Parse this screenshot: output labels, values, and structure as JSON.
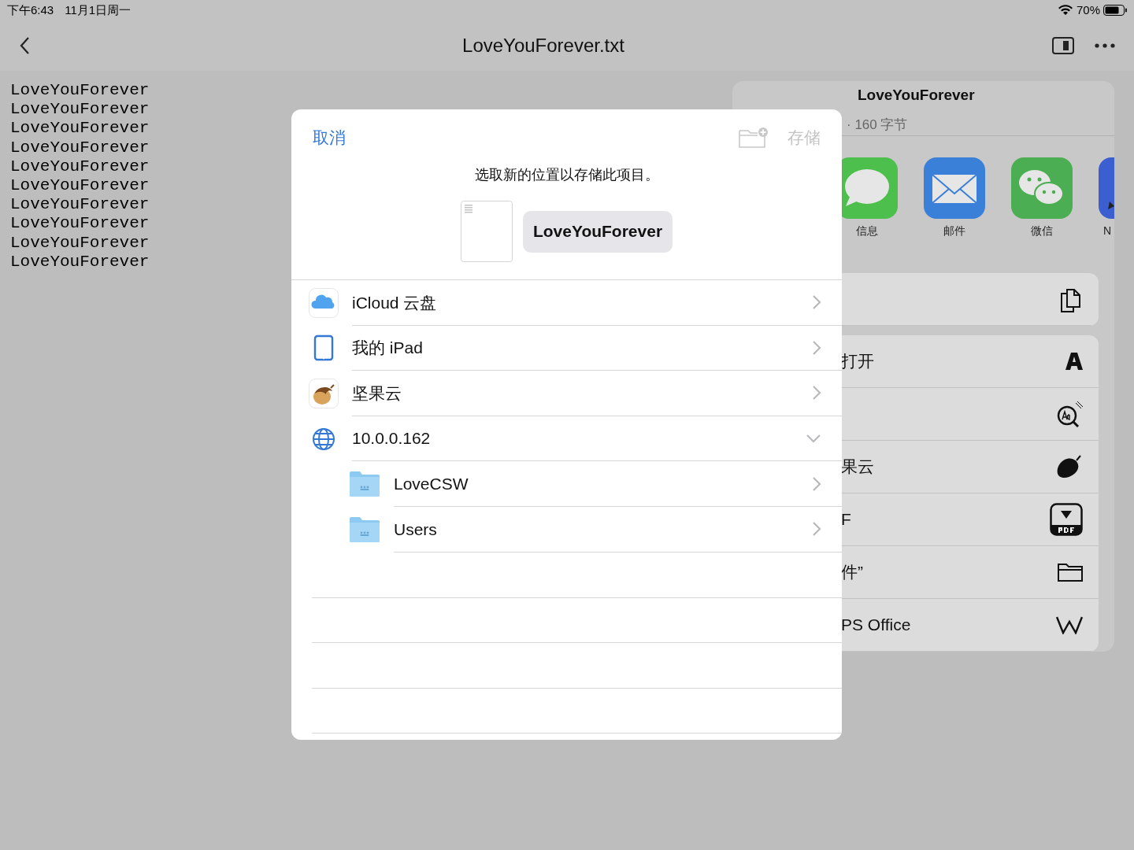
{
  "status_bar": {
    "time": "下午6:43",
    "date": "11月1日周一",
    "battery": "70%"
  },
  "nav": {
    "title": "LoveYouForever.txt"
  },
  "document": {
    "lines": [
      "LoveYouForever",
      "LoveYouForever",
      "LoveYouForever",
      "LoveYouForever",
      "LoveYouForever",
      "LoveYouForever",
      "LoveYouForever",
      "LoveYouForever",
      "LoveYouForever",
      "LoveYouForever"
    ]
  },
  "share_sheet": {
    "title": "LoveYouForever",
    "subtitle": "· 160 字节",
    "apps": [
      {
        "label": "信息",
        "kind": "messages"
      },
      {
        "label": "邮件",
        "kind": "mail"
      },
      {
        "label": "微信",
        "kind": "wechat"
      },
      {
        "label": "N",
        "kind": "notes"
      }
    ],
    "actions": [
      {
        "kind": "copy"
      },
      {
        "label": "打开",
        "kind": "font"
      },
      {
        "kind": "dictionary"
      },
      {
        "label": "果云",
        "kind": "nut"
      },
      {
        "label": "F",
        "kind": "pdf"
      },
      {
        "label": "件”",
        "kind": "folder"
      },
      {
        "label": "PS Office",
        "kind": "wps"
      }
    ]
  },
  "save_dialog": {
    "cancel": "取消",
    "save": {
      "label": "存储",
      "disabled": true
    },
    "prompt": "选取新的位置以存储此项目。",
    "file_name": "LoveYouForever",
    "locations": [
      {
        "name": "iCloud 云盘",
        "kind": "icloud",
        "expanded": false
      },
      {
        "name": "我的 iPad",
        "kind": "ipad",
        "expanded": false
      },
      {
        "name": "坚果云",
        "kind": "nut",
        "expanded": false
      },
      {
        "name": "10.0.0.162",
        "kind": "server",
        "expanded": true,
        "children": [
          {
            "name": "LoveCSW",
            "kind": "folder"
          },
          {
            "name": "Users",
            "kind": "folder"
          }
        ]
      }
    ]
  }
}
